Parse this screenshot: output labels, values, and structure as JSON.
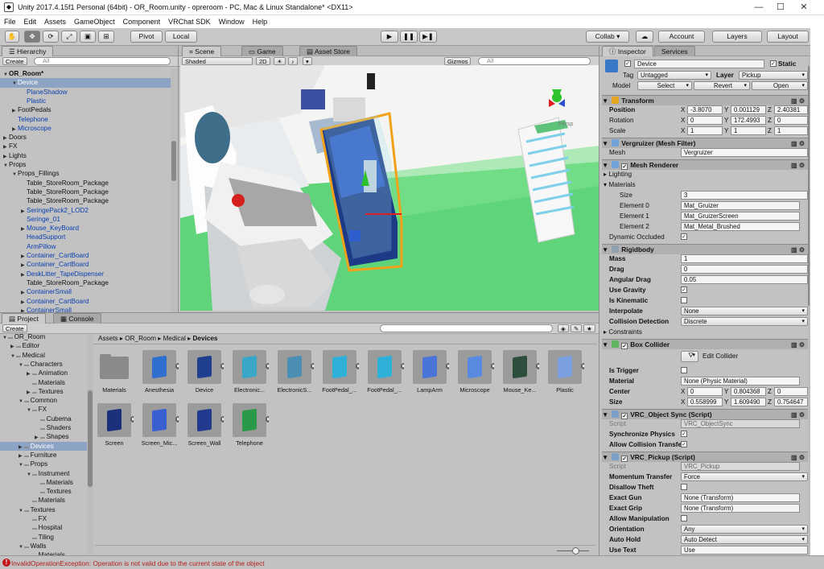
{
  "window": {
    "title": "Unity 2017.4.15f1 Personal (64bit) - OR_Room.unity - opreroom - PC, Mac & Linux Standalone* <DX11>",
    "min": "—",
    "max": "☐",
    "close": "✕"
  },
  "menu": [
    "File",
    "Edit",
    "Assets",
    "GameObject",
    "Component",
    "VRChat SDK",
    "Window",
    "Help"
  ],
  "toolbar": {
    "pivot": "Pivot",
    "local": "Local",
    "collab": "Collab ▾",
    "account": "Account",
    "layers": "Layers",
    "layout": "Layout"
  },
  "hierarchy": {
    "tab": "Hierarchy",
    "create": "Create",
    "search_placeholder": "All",
    "rows": [
      {
        "t": "OR_Room*",
        "d": 0,
        "a": "▼",
        "bold": true
      },
      {
        "t": "Device",
        "d": 1,
        "a": "▼",
        "sel": true
      },
      {
        "t": "PlaneShadow",
        "d": 2,
        "a": "",
        "blue": true
      },
      {
        "t": "Plastic",
        "d": 2,
        "a": "",
        "blue": true
      },
      {
        "t": "FootPedals",
        "d": 1,
        "a": "▶"
      },
      {
        "t": "Telephone",
        "d": 1,
        "a": "",
        "blue": true
      },
      {
        "t": "Microscope",
        "d": 1,
        "a": "▶",
        "blue": true
      },
      {
        "t": "Doors",
        "d": 0,
        "a": "▶"
      },
      {
        "t": "FX",
        "d": 0,
        "a": "▶"
      },
      {
        "t": "Lights",
        "d": 0,
        "a": "▶"
      },
      {
        "t": "Props",
        "d": 0,
        "a": "▼"
      },
      {
        "t": "Props_Fillings",
        "d": 1,
        "a": "▼"
      },
      {
        "t": "Table_StoreRoom_Package",
        "d": 2,
        "a": ""
      },
      {
        "t": "Table_StoreRoom_Package",
        "d": 2,
        "a": ""
      },
      {
        "t": "Table_StoreRoom_Package",
        "d": 2,
        "a": ""
      },
      {
        "t": "SeringePack2_LOD2",
        "d": 2,
        "a": "▶",
        "blue": true
      },
      {
        "t": "Seringe_01",
        "d": 2,
        "a": "",
        "blue": true
      },
      {
        "t": "Mouse_KeyBoard",
        "d": 2,
        "a": "▶",
        "blue": true
      },
      {
        "t": "HeadSupport",
        "d": 2,
        "a": "",
        "blue": true
      },
      {
        "t": "ArmPillow",
        "d": 2,
        "a": "",
        "blue": true
      },
      {
        "t": "Container_CartBoard",
        "d": 2,
        "a": "▶",
        "blue": true
      },
      {
        "t": "Container_CartBoard",
        "d": 2,
        "a": "▶",
        "blue": true
      },
      {
        "t": "DeskLitter_TapeDispenser",
        "d": 2,
        "a": "▶",
        "blue": true
      },
      {
        "t": "Table_StoreRoom_Package",
        "d": 2,
        "a": ""
      },
      {
        "t": "ContainerSmall",
        "d": 2,
        "a": "▶",
        "blue": true
      },
      {
        "t": "Container_CartBoard",
        "d": 2,
        "a": "▶",
        "blue": true
      },
      {
        "t": "ContainerSmall",
        "d": 2,
        "a": "▶",
        "blue": true
      }
    ]
  },
  "scene": {
    "tabs": [
      "Scene",
      "Game",
      "Asset Store"
    ],
    "shading": "Shaded",
    "mode2d": "2D",
    "gizmos": "Gizmos",
    "search_placeholder": "All",
    "persp": "Persp"
  },
  "project": {
    "tabs": [
      "Project",
      "Console"
    ],
    "create": "Create",
    "breadcrumb": [
      "Assets",
      "OR_Room",
      "Medical",
      "Devices"
    ],
    "tree": [
      {
        "t": "OR_Room",
        "d": 0,
        "a": "▼"
      },
      {
        "t": "Editor",
        "d": 1,
        "a": "▶"
      },
      {
        "t": "Medical",
        "d": 1,
        "a": "▼"
      },
      {
        "t": "Characters",
        "d": 2,
        "a": "▼"
      },
      {
        "t": "Animation",
        "d": 3,
        "a": "▶"
      },
      {
        "t": "Materials",
        "d": 3,
        "a": ""
      },
      {
        "t": "Textures",
        "d": 3,
        "a": "▶"
      },
      {
        "t": "Common",
        "d": 2,
        "a": "▼"
      },
      {
        "t": "FX",
        "d": 3,
        "a": "▼"
      },
      {
        "t": "Cubema",
        "d": 4,
        "a": ""
      },
      {
        "t": "Shaders",
        "d": 4,
        "a": ""
      },
      {
        "t": "Shapes",
        "d": 4,
        "a": "▶"
      },
      {
        "t": "Devices",
        "d": 2,
        "a": "▶",
        "sel": true
      },
      {
        "t": "Furniture",
        "d": 2,
        "a": "▶"
      },
      {
        "t": "Props",
        "d": 2,
        "a": "▼"
      },
      {
        "t": "Instrument",
        "d": 3,
        "a": "▼"
      },
      {
        "t": "Materials",
        "d": 4,
        "a": ""
      },
      {
        "t": "Textures",
        "d": 4,
        "a": ""
      },
      {
        "t": "Materials",
        "d": 3,
        "a": ""
      },
      {
        "t": "Textures",
        "d": 2,
        "a": "▼"
      },
      {
        "t": "FX",
        "d": 3,
        "a": ""
      },
      {
        "t": "Hospital",
        "d": 3,
        "a": ""
      },
      {
        "t": "Tiling",
        "d": 3,
        "a": ""
      },
      {
        "t": "Walls",
        "d": 2,
        "a": "▼"
      },
      {
        "t": "Materials",
        "d": 3,
        "a": ""
      }
    ],
    "assets": [
      {
        "n": "Materials",
        "icon": "folder",
        "c": "#8a8a8a"
      },
      {
        "n": "Anesthesia",
        "icon": "prefab",
        "c": "#2f6fd0"
      },
      {
        "n": "Device",
        "icon": "prefab",
        "c": "#1f3f8f"
      },
      {
        "n": "Electronic...",
        "icon": "prefab",
        "c": "#3aa7c9"
      },
      {
        "n": "ElectronicS...",
        "icon": "prefab",
        "c": "#4b8fb5"
      },
      {
        "n": "FootPedal_...",
        "icon": "prefab",
        "c": "#2fb0d8"
      },
      {
        "n": "FootPedal_...",
        "icon": "prefab",
        "c": "#2fb0d8"
      },
      {
        "n": "LampArm",
        "icon": "prefab",
        "c": "#4a74d8"
      },
      {
        "n": "Microscope",
        "icon": "prefab",
        "c": "#5a8ae0"
      },
      {
        "n": "Mouse_Ke...",
        "icon": "prefab",
        "c": "#2d4d3d"
      },
      {
        "n": "Plastic",
        "icon": "prefab",
        "c": "#7aa0e0"
      },
      {
        "n": "Screen",
        "icon": "prefab",
        "c": "#1c2f7a"
      },
      {
        "n": "Screen_Mic...",
        "icon": "prefab",
        "c": "#3a5fd0"
      },
      {
        "n": "Screen_Wall",
        "icon": "prefab",
        "c": "#223a8e"
      },
      {
        "n": "Telephone",
        "icon": "prefab",
        "c": "#2a9a4a"
      }
    ]
  },
  "inspector": {
    "tabs": [
      "Inspector",
      "Services"
    ],
    "object_name": "Device",
    "static": "Static",
    "tag_label": "Tag",
    "tag": "Untagged",
    "layer_label": "Layer",
    "layer": "Pickup",
    "model_label": "Model",
    "select": "Select",
    "revert": "Revert",
    "open": "Open",
    "transform": {
      "title": "Transform",
      "position": [
        "-3.8070",
        "0.001129",
        "2.40381"
      ],
      "rotation": [
        "0",
        "172.4993",
        "0"
      ],
      "scale": [
        "1",
        "1",
        "1"
      ],
      "labels": [
        "Position",
        "Rotation",
        "Scale"
      ]
    },
    "mesh_filter": {
      "title": "Vergruizer (Mesh Filter)",
      "mesh_label": "Mesh",
      "mesh": "Vergruizer"
    },
    "mesh_renderer": {
      "title": "Mesh Renderer",
      "lighting": "Lighting",
      "materials": "Materials",
      "size_label": "Size",
      "size": "3",
      "elements": [
        {
          "l": "Element 0",
          "v": "Mat_Gruizer"
        },
        {
          "l": "Element 1",
          "v": "Mat_GruizerScreen"
        },
        {
          "l": "Element 2",
          "v": "Mat_Metal_Brushed"
        }
      ],
      "dynamic_occluded": "Dynamic Occluded"
    },
    "rigidbody": {
      "title": "Rigidbody",
      "mass_label": "Mass",
      "mass": "1",
      "drag_label": "Drag",
      "drag": "0",
      "angular_drag_label": "Angular Drag",
      "angular_drag": "0.05",
      "use_gravity": "Use Gravity",
      "is_kinematic": "Is Kinematic",
      "interpolate_label": "Interpolate",
      "interpolate": "None",
      "collision_label": "Collision Detection",
      "collision": "Discrete",
      "constraints": "Constraints"
    },
    "box_collider": {
      "title": "Box Collider",
      "edit": "Edit Collider",
      "is_trigger": "Is Trigger",
      "material_label": "Material",
      "material": "None (Physic Material)",
      "center_label": "Center",
      "center": [
        "0",
        "0.804368",
        "0"
      ],
      "size_label": "Size",
      "size": [
        "0.558999",
        "1.609490",
        "0.754647"
      ]
    },
    "object_sync": {
      "title": "VRC_Object Sync (Script)",
      "script_label": "Script",
      "script": "VRC_ObjectSync",
      "sync_physics": "Synchronize Physics",
      "allow_collision": "Allow Collision Transfer"
    },
    "pickup": {
      "title": "VRC_Pickup (Script)",
      "script_label": "Script",
      "script": "VRC_Pickup",
      "momentum_label": "Momentum Transfer",
      "momentum": "Force",
      "disallow_theft": "Disallow Theft",
      "exact_gun_label": "Exact Gun",
      "exact_gun": "None (Transform)",
      "exact_grip_label": "Exact Grip",
      "exact_grip": "None (Transform)",
      "allow_manip": "Allow Manipulation",
      "orientation_label": "Orientation",
      "orientation": "Any",
      "autohold_label": "Auto Hold",
      "autohold": "Auto Detect",
      "usetext_label": "Use Text",
      "usetext": "Use"
    }
  },
  "status": {
    "message": "InvalidOperationException: Operation is not valid due to the current state of the object"
  }
}
